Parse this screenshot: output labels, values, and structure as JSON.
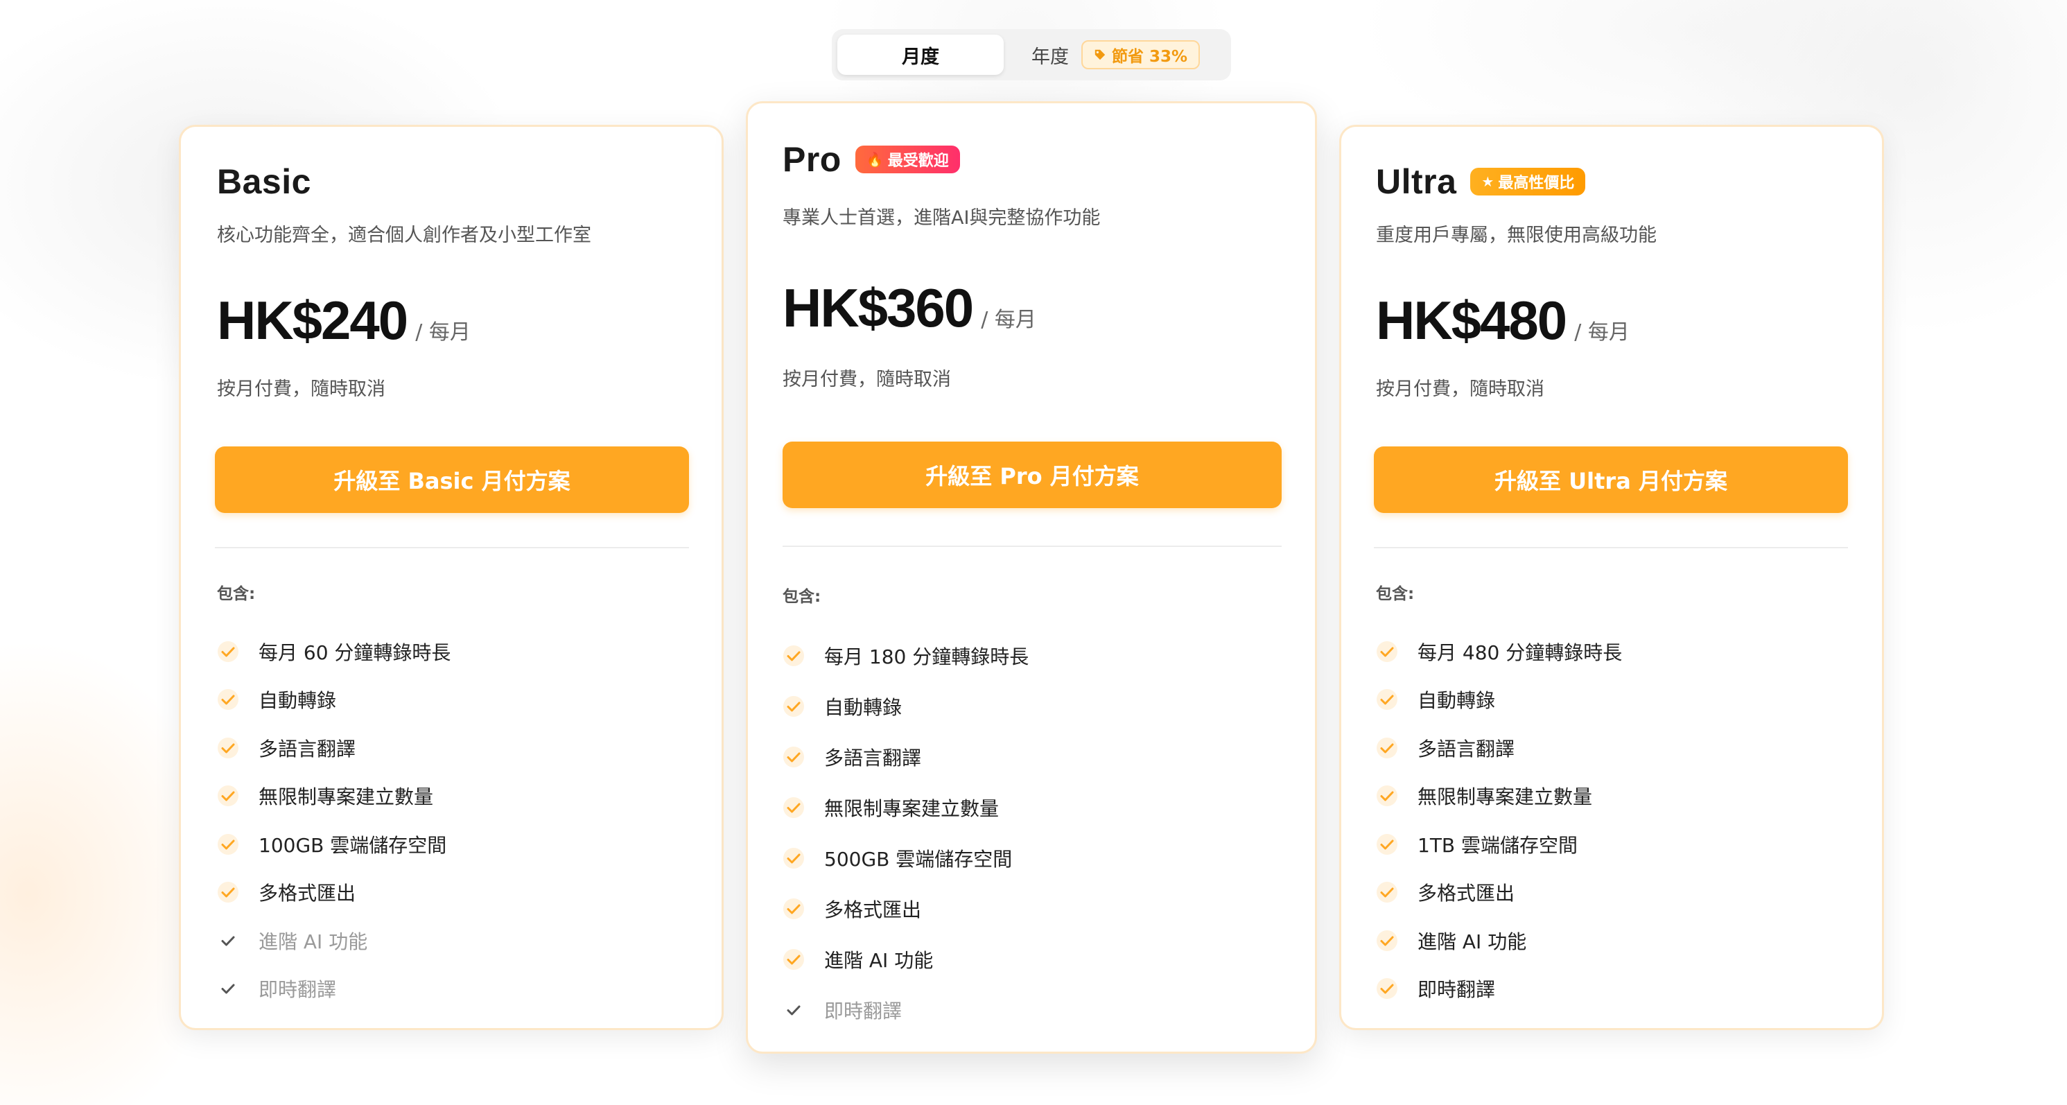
{
  "billing_toggle": {
    "monthly_label": "月度",
    "yearly_label": "年度",
    "yearly_badge": "節省 33%",
    "selected": "月度"
  },
  "includes_label": "包含:",
  "colors": {
    "accent": "#ffa722",
    "check_active": "#ffa722",
    "check_inactive": "#555555",
    "hot_badge": "#ff4060",
    "card_border": "#fde7c7"
  },
  "plans": [
    {
      "name": "Basic",
      "badge": "",
      "description": "核心功能齊全，適合個人創作者及小型工作室",
      "price": "HK$240",
      "period": "/ 每月",
      "billing_note": "按月付費，隨時取消",
      "cta_label": "升級至 Basic 月付方案",
      "features": [
        {
          "label": "每月 60 分鐘轉錄時長",
          "included": true
        },
        {
          "label": "自動轉錄",
          "included": true
        },
        {
          "label": "多語言翻譯",
          "included": true
        },
        {
          "label": "無限制專案建立數量",
          "included": true
        },
        {
          "label": "100GB 雲端儲存空間",
          "included": true
        },
        {
          "label": "多格式匯出",
          "included": true
        },
        {
          "label": "進階 AI 功能",
          "included": false
        },
        {
          "label": "即時翻譯",
          "included": false
        }
      ]
    },
    {
      "name": "Pro",
      "badge": "最受歡迎",
      "badge_icon": "fire-icon",
      "description": "專業人士首選，進階AI與完整協作功能",
      "price": "HK$360",
      "period": "/ 每月",
      "billing_note": "按月付費，隨時取消",
      "cta_label": "升級至 Pro 月付方案",
      "features": [
        {
          "label": "每月 180 分鐘轉錄時長",
          "included": true
        },
        {
          "label": "自動轉錄",
          "included": true
        },
        {
          "label": "多語言翻譯",
          "included": true
        },
        {
          "label": "無限制專案建立數量",
          "included": true
        },
        {
          "label": "500GB 雲端儲存空間",
          "included": true
        },
        {
          "label": "多格式匯出",
          "included": true
        },
        {
          "label": "進階 AI 功能",
          "included": true
        },
        {
          "label": "即時翻譯",
          "included": false
        }
      ]
    },
    {
      "name": "Ultra",
      "badge": "最高性價比",
      "badge_icon": "star-icon",
      "description": "重度用戶專屬，無限使用高級功能",
      "price": "HK$480",
      "period": "/ 每月",
      "billing_note": "按月付費，隨時取消",
      "cta_label": "升級至 Ultra 月付方案",
      "features": [
        {
          "label": "每月 480 分鐘轉錄時長",
          "included": true
        },
        {
          "label": "自動轉錄",
          "included": true
        },
        {
          "label": "多語言翻譯",
          "included": true
        },
        {
          "label": "無限制專案建立數量",
          "included": true
        },
        {
          "label": "1TB 雲端儲存空間",
          "included": true
        },
        {
          "label": "多格式匯出",
          "included": true
        },
        {
          "label": "進階 AI 功能",
          "included": true
        },
        {
          "label": "即時翻譯",
          "included": true
        }
      ]
    }
  ]
}
